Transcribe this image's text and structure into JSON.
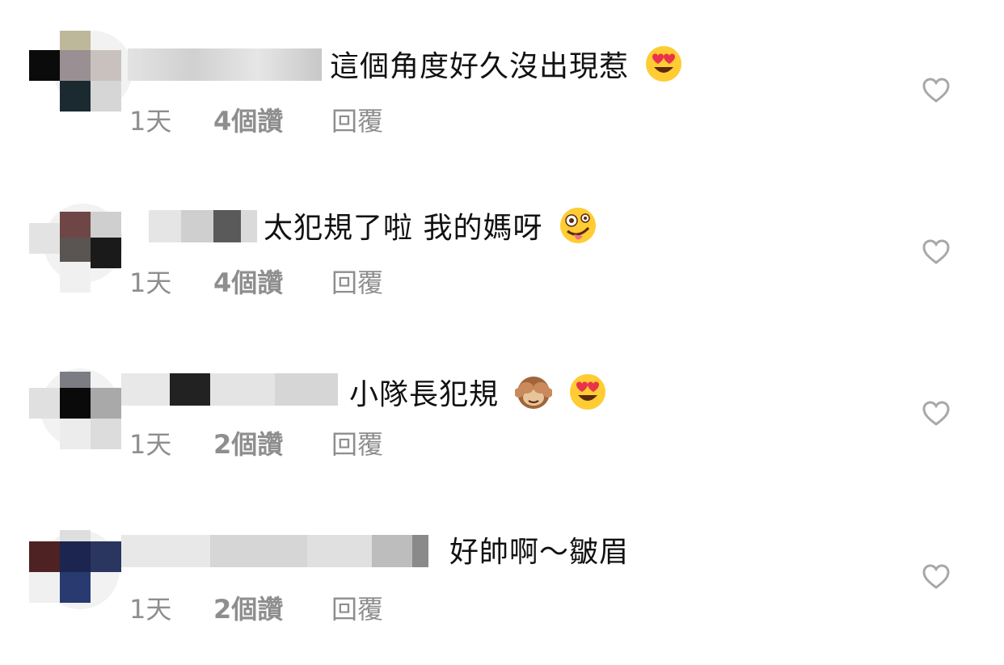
{
  "comments": [
    {
      "text": "這個角度好久沒出現惹",
      "emoji": [
        "heart-eyes-emoji"
      ],
      "time": "1天",
      "likes": "4個讚",
      "reply": "回覆"
    },
    {
      "text": "太犯規了啦 我的媽呀",
      "emoji": [
        "zany-face-emoji"
      ],
      "time": "1天",
      "likes": "4個讚",
      "reply": "回覆"
    },
    {
      "text": "小隊長犯規",
      "emoji": [
        "see-no-evil-monkey-emoji",
        "heart-eyes-emoji"
      ],
      "time": "1天",
      "likes": "2個讚",
      "reply": "回覆"
    },
    {
      "text": "好帥啊～皺眉",
      "emoji": [],
      "time": "1天",
      "likes": "2個讚",
      "reply": "回覆"
    }
  ],
  "colors": {
    "meta_gray": "#8e8e8e",
    "heart_gray": "#a8a8a8"
  }
}
